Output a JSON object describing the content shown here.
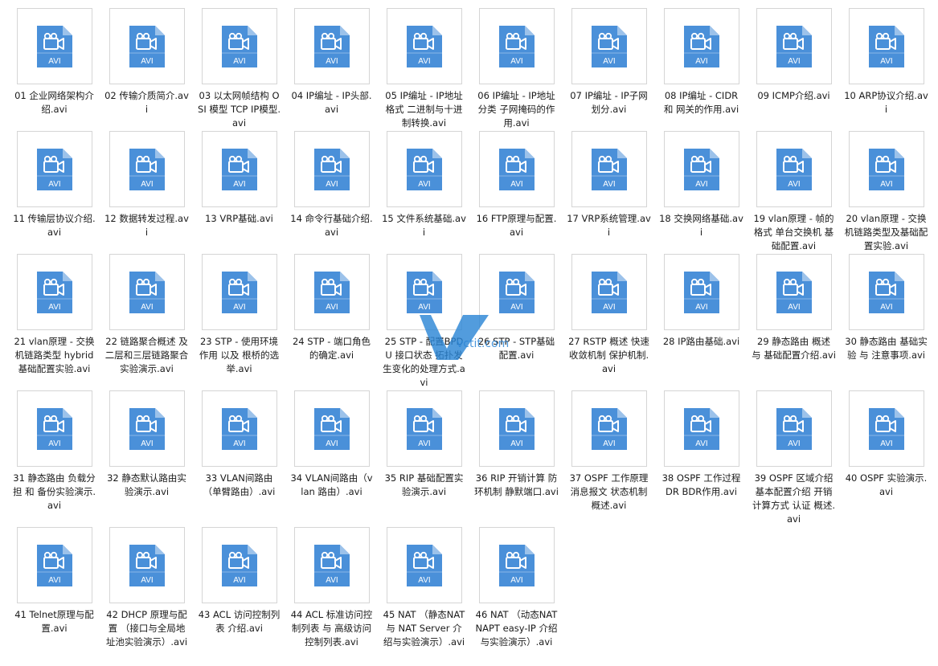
{
  "file_type_label": "AVI",
  "colors": {
    "icon_blue": "#4a90d9",
    "icon_fold": "#9cc2ea",
    "watermark": "#2c86d6"
  },
  "icon_name": "avi-video-file-icon",
  "watermark": {
    "text": "vctit.com"
  },
  "files": [
    "01 企业网络架构介绍.avi",
    "02 传输介质简介.avi",
    "03 以太网帧结构 OSI 模型  TCP IP模型.avi",
    "04 IP编址 - IP头部.avi",
    "05 IP编址 - IP地址格式 二进制与十进制转换.avi",
    "06 IP编址 - IP地址分类 子网掩码的作用.avi",
    "07 IP编址 - IP子网划分.avi",
    "08 IP编址 - CIDR 和 网关的作用.avi",
    "09 ICMP介绍.avi",
    "10 ARP协议介绍.avi",
    "11 传输层协议介绍.avi",
    "12 数据转发过程.avi",
    "13 VRP基础.avi",
    "14 命令行基础介绍.avi",
    "15 文件系统基础.avi",
    "16 FTP原理与配置.avi",
    "17 VRP系统管理.avi",
    "18 交换网络基础.avi",
    "19 vlan原理 - 帧的格式 单台交换机 基础配置.avi",
    "20 vlan原理 - 交换机链路类型及基础配置实验.avi",
    "21 vlan原理 - 交换机链路类型 hybrid 基础配置实验.avi",
    "22 链路聚合概述 及 二层和三层链路聚合实验演示.avi",
    "23 STP - 使用环境  作用  以及 根桥的选举.avi",
    "24 STP - 端口角色的确定.avi",
    "25 STP - 配置BPDU 接口状态 拓扑发生变化的处理方式.avi",
    "26 STP - STP基础配置.avi",
    "27 RSTP  概述 快速收敛机制 保护机制.avi",
    "28 IP路由基础.avi",
    "29 静态路由 概述 与 基础配置介绍.avi",
    "30 静态路由 基础实验 与 注意事项.avi",
    "31 静态路由 负载分担 和 备份实验演示.avi",
    "32 静态默认路由实验演示.avi",
    "33 VLAN间路由（单臂路由）.avi",
    "34 VLAN间路由（vlan 路由）.avi",
    "35 RIP 基础配置实验演示.avi",
    "36 RIP 开销计算 防环机制 静默端口.avi",
    "37 OSPF  工作原理 消息报文 状态机制 概述.avi",
    "38 OSPF  工作过程   DR BDR作用.avi",
    "39 OSPF 区域介绍  基本配置介绍 开销计算方式 认证 概述.avi",
    "40 OSPF 实验演示.avi",
    "41 Telnet原理与配置.avi",
    "42 DHCP 原理与配置 （接口与全局地址池实验演示）.avi",
    "43 ACL 访问控制列表 介绍.avi",
    "44 ACL 标准访问控制列表 与 高级访问控制列表.avi",
    "45 NAT （静态NAT 与 NAT Server 介绍与实验演示）.avi",
    "46 NAT （动态NAT NAPT easy-IP 介绍与实验演示）.avi"
  ]
}
